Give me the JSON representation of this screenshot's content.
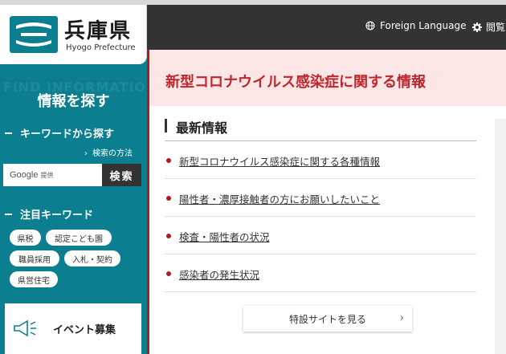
{
  "logo": {
    "title": "兵庫県",
    "subtitle": "Hyogo Prefecture"
  },
  "sidebar": {
    "bg_label": "FIND INFORMATION",
    "title": "情報を探す",
    "keyword_heading": "キーワードから探す",
    "search_how": "検索の方法",
    "search_google": "Google",
    "search_provided": "提供",
    "search_button": "検索",
    "attention_heading": "注目キーワード",
    "tags": [
      "県税",
      "認定こども園",
      "職員採用",
      "入札・契約",
      "県営住宅"
    ],
    "event_label": "イベント募集"
  },
  "topbar": {
    "foreign_language": "Foreign Language",
    "view_label": "閲覧"
  },
  "banner": {
    "title": "新型コロナウイルス感染症に関する情報"
  },
  "news": {
    "heading": "最新情報",
    "items": [
      "新型コロナウイルス感染症に関する各種情報",
      "陽性者・濃厚接触者の方にお願いしたいこと",
      "検査・陽性者の状況",
      "感染者の発生状況"
    ],
    "more_button": "特設サイトを見る"
  },
  "colors": {
    "teal": "#0b7f8f",
    "dark": "#333333",
    "accent_red": "#c0272d",
    "banner_bg": "#fde6e6"
  }
}
